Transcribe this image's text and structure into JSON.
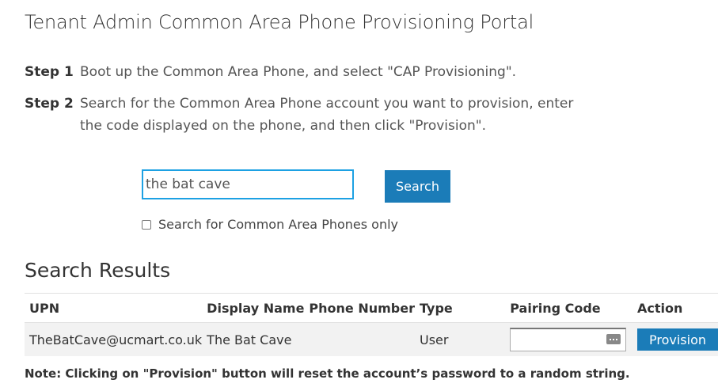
{
  "page": {
    "title": "Tenant Admin Common Area Phone Provisioning Portal"
  },
  "steps": [
    {
      "label": "Step 1",
      "text": "Boot up the Common Area Phone, and select \"CAP Provisioning\"."
    },
    {
      "label": "Step 2",
      "text_line1": "Search for the Common Area Phone account you want to provision, enter",
      "text_line2": "the code displayed on the phone, and then click \"Provision\"."
    }
  ],
  "search": {
    "value": "the bat cave",
    "button_label": "Search",
    "checkbox_label": "Search for Common Area Phones only",
    "checkbox_checked": false
  },
  "results": {
    "heading": "Search Results",
    "columns": [
      "UPN",
      "Display Name",
      "Phone Number",
      "Type",
      "Pairing Code",
      "Action"
    ],
    "rows": [
      {
        "upn": "TheBatCave@ucmart.co.uk",
        "display_name": "The Bat Cave",
        "phone_number": "",
        "type": "User",
        "pairing_code": "",
        "action_label": "Provision"
      }
    ]
  },
  "note": "Note: Clicking on \"Provision\" button will reset the account’s password to a random string.",
  "colors": {
    "accent": "#1b7cb8",
    "focus_border": "#1da1e3",
    "row_background": "#f2f2f2"
  }
}
